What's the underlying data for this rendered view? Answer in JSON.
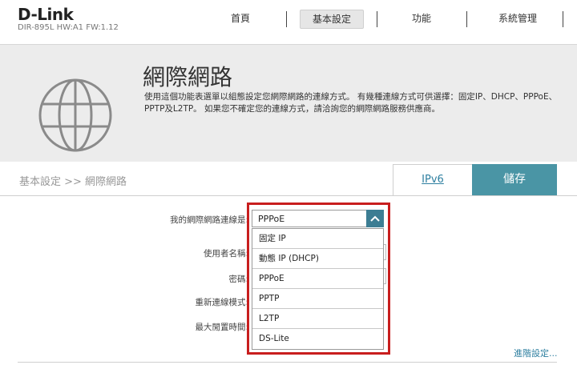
{
  "header": {
    "logo": "D-Link",
    "model": "DIR-895L HW:A1 FW:1.12",
    "nav": [
      {
        "label": "首頁"
      },
      {
        "label": "基本設定"
      },
      {
        "label": "功能"
      },
      {
        "label": "系統管理"
      }
    ],
    "active_nav": "基本設定"
  },
  "banner": {
    "title": "網際網路",
    "description": "使用這個功能表選單以組態設定您網際網路的連線方式。 有幾種連線方式可供選擇：固定IP、DHCP、PPPoE、PPTP及L2TP。 如果您不確定您的連線方式，請洽詢您的網際網路服務供應商。",
    "icon": "globe-icon"
  },
  "subbar": {
    "breadcrumb": "基本設定 >> 網際網路",
    "ipv6_tab": "IPv6",
    "save_label": "儲存"
  },
  "form": {
    "connection_label": "我的網際網路連線是:",
    "username_label": "使用者名稱:",
    "password_label": "密碼:",
    "reconnect_label": "重新連線模式:",
    "idle_label": "最大閒置時間:"
  },
  "dropdown": {
    "selected": "PPPoE",
    "options": [
      "固定 IP",
      "動態 IP (DHCP)",
      "PPPoE",
      "PPTP",
      "L2TP",
      "DS-Lite"
    ]
  },
  "advanced_link": "進階設定...",
  "colors": {
    "accent": "#4a95a5",
    "highlight_border": "#c81e1e",
    "link": "#2e7fa0"
  }
}
